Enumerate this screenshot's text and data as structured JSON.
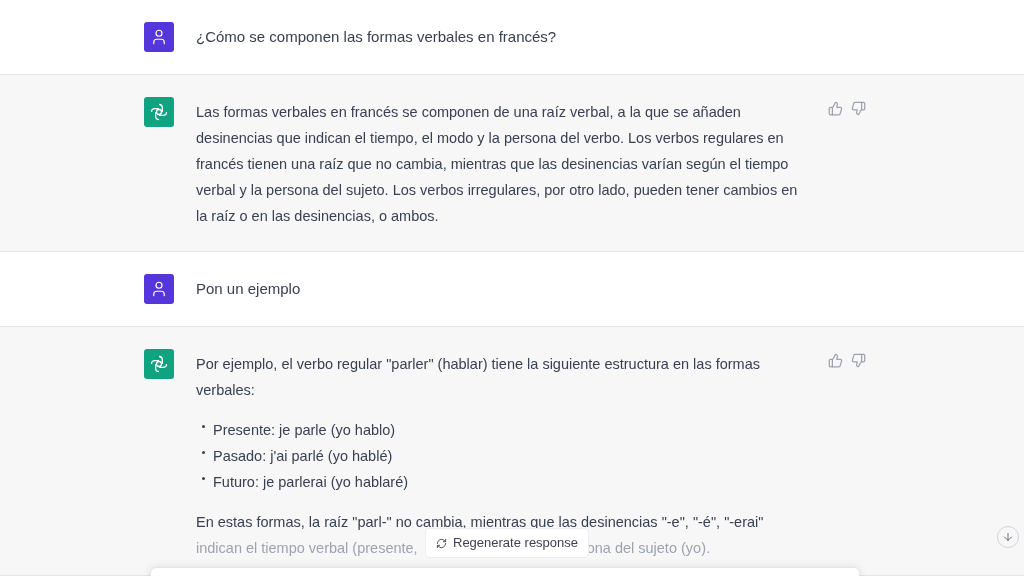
{
  "messages": [
    {
      "kind": "user",
      "text": "¿Cómo se componen las formas verbales en francés?"
    },
    {
      "kind": "assistant",
      "paragraphs": [
        "Las formas verbales en francés se componen de una raíz verbal, a la que se añaden desinencias que indican el tiempo, el modo y la persona del verbo. Los verbos regulares en francés tienen una raíz que no cambia, mientras que las desinencias varían según el tiempo verbal y la persona del sujeto. Los verbos irregulares, por otro lado, pueden tener cambios en la raíz o en las desinencias, o ambos."
      ]
    },
    {
      "kind": "user",
      "text": "Pon un ejemplo"
    },
    {
      "kind": "assistant",
      "paragraphs": [
        "Por ejemplo, el verbo regular \"parler\" (hablar) tiene la siguiente estructura en las formas verbales:"
      ],
      "bullets": [
        "Presente: je parle (yo hablo)",
        "Pasado: j'ai parlé (yo hablé)",
        "Futuro: je parlerai (yo hablaré)"
      ],
      "last_line": "En estas formas, la raíz \"parl-\" no cambia, mientras que las desinencias \"-e\", \"-é\", \"-erai\"",
      "faded_start": "indican el tiempo verbal (presente,",
      "faded_end": "ona del sujeto (yo)."
    }
  ],
  "regenerate_button": "Regenerate response"
}
